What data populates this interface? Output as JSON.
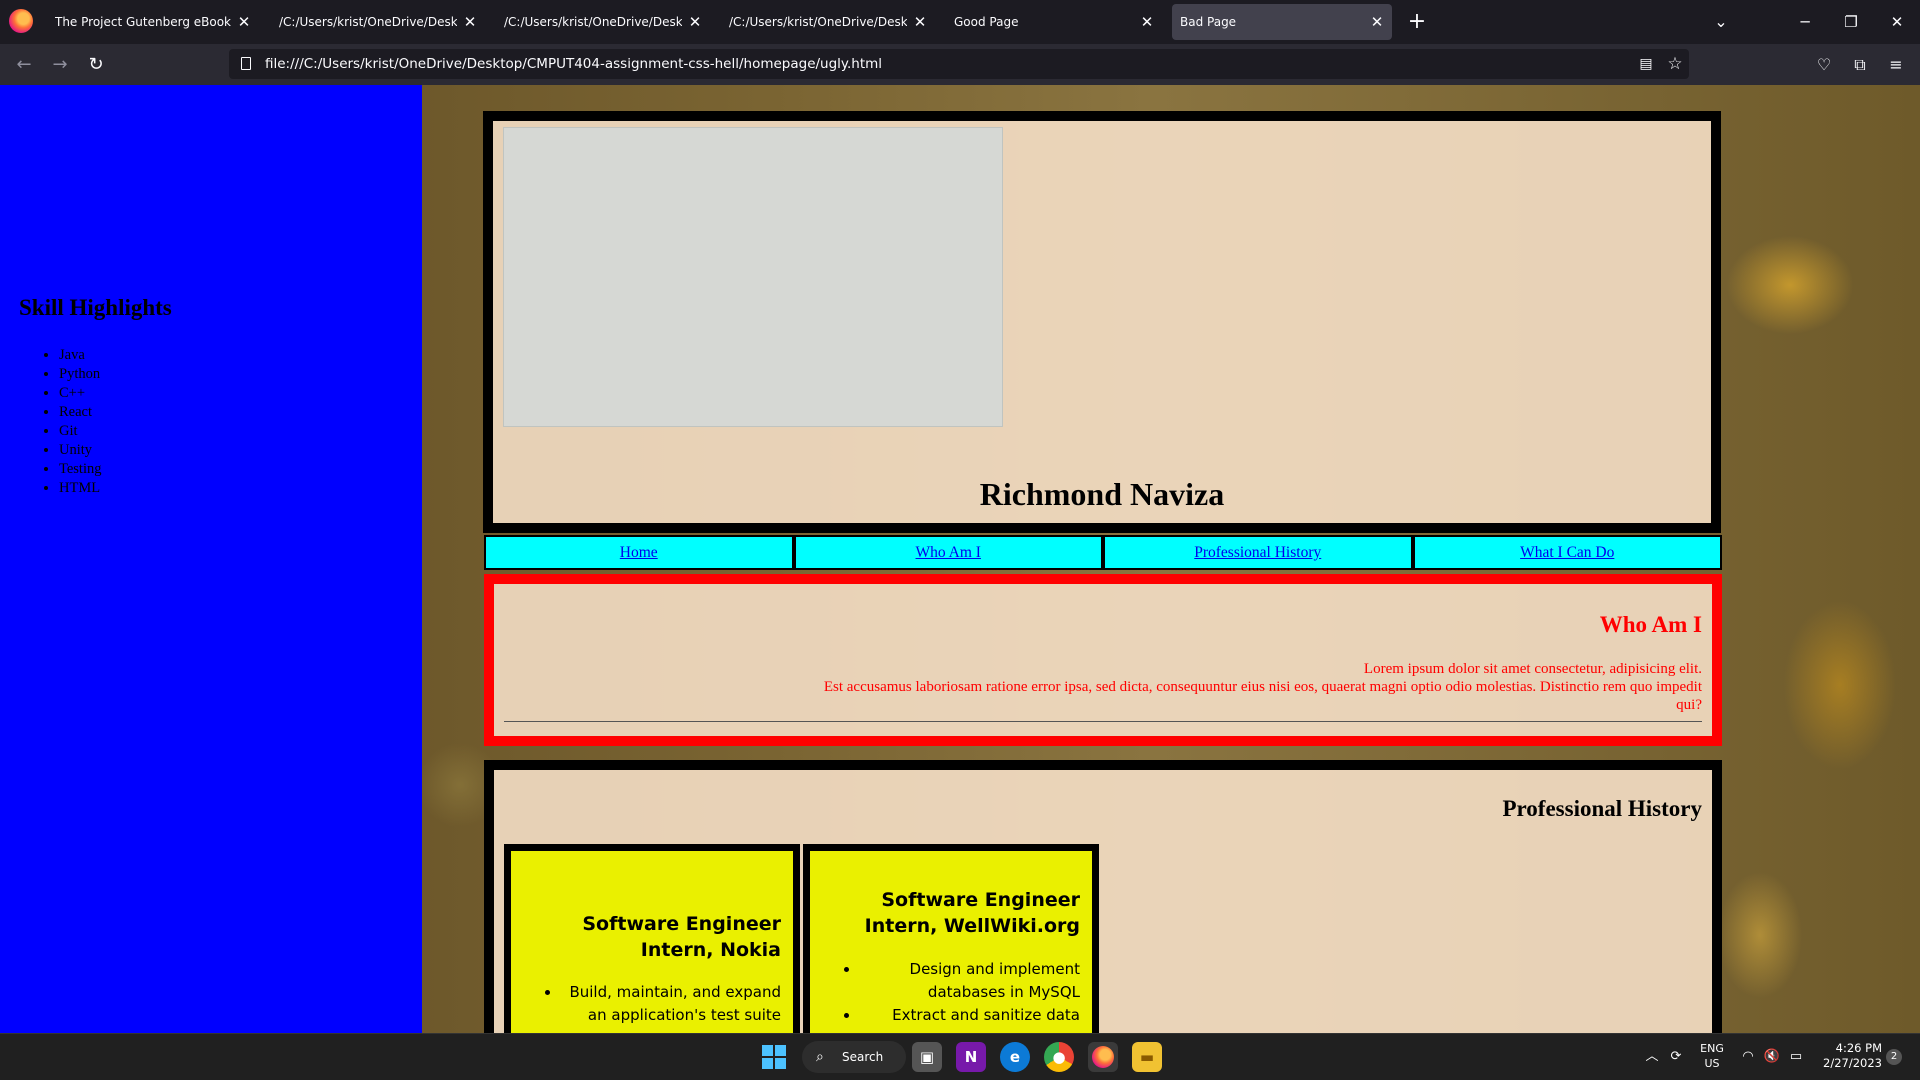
{
  "browser": {
    "tabs": [
      {
        "title": "The Project Gutenberg eBook of Fra",
        "close": "✕"
      },
      {
        "title": "/C:/Users/krist/OneDrive/Desktop/C",
        "close": "✕"
      },
      {
        "title": "/C:/Users/krist/OneDrive/Desktop/C",
        "close": "✕"
      },
      {
        "title": "/C:/Users/krist/OneDrive/Desktop/C",
        "close": "✕"
      },
      {
        "title": "Good Page",
        "close": "✕"
      },
      {
        "title": "Bad Page",
        "close": "✕"
      }
    ],
    "active_tab": "Bad Page",
    "new_tab_glyph": "+",
    "url": "file:///C:/Users/krist/OneDrive/Desktop/CMPUT404-assignment-css-hell/homepage/ugly.html"
  },
  "page": {
    "sidebar": {
      "title": "Skill Highlights",
      "skills": [
        "Java",
        "Python",
        "C++",
        "React",
        "Git",
        "Unity",
        "Testing",
        "HTML"
      ]
    },
    "header": {
      "name": "Richmond Naviza",
      "portrait_placeholder": ""
    },
    "nav": [
      "Home",
      "Who Am I",
      "Professional History",
      "What I Can Do"
    ],
    "who_am_i": {
      "title": "Who Am I",
      "line1": "Lorem ipsum dolor sit amet consectetur, adipisicing elit.",
      "line2": "Est accusamus laboriosam ratione error ipsa, sed dicta, consequuntur eius nisi eos, quaerat magni optio odio molestias. Distinctio rem quo impedit qui?"
    },
    "professional_history": {
      "title": "Professional History",
      "jobs": [
        {
          "title": "Software Engineer Intern, Nokia",
          "bullets": [
            "Build, maintain, and expand an application's test suite"
          ]
        },
        {
          "title": "Software Engineer Intern, WellWiki.org",
          "bullets": [
            "Design and implement databases in MySQL",
            "Extract and sanitize data"
          ]
        }
      ]
    },
    "colors": {
      "sidebar": "#0000ff",
      "nav_bg": "#00ffff",
      "who_border": "#ff0000",
      "job_bg": "#eaf000"
    }
  },
  "taskbar": {
    "search_label": "Search",
    "language": "ENG",
    "region": "US",
    "time": "4:26 PM",
    "date": "2/27/2023",
    "notifications": "2"
  }
}
